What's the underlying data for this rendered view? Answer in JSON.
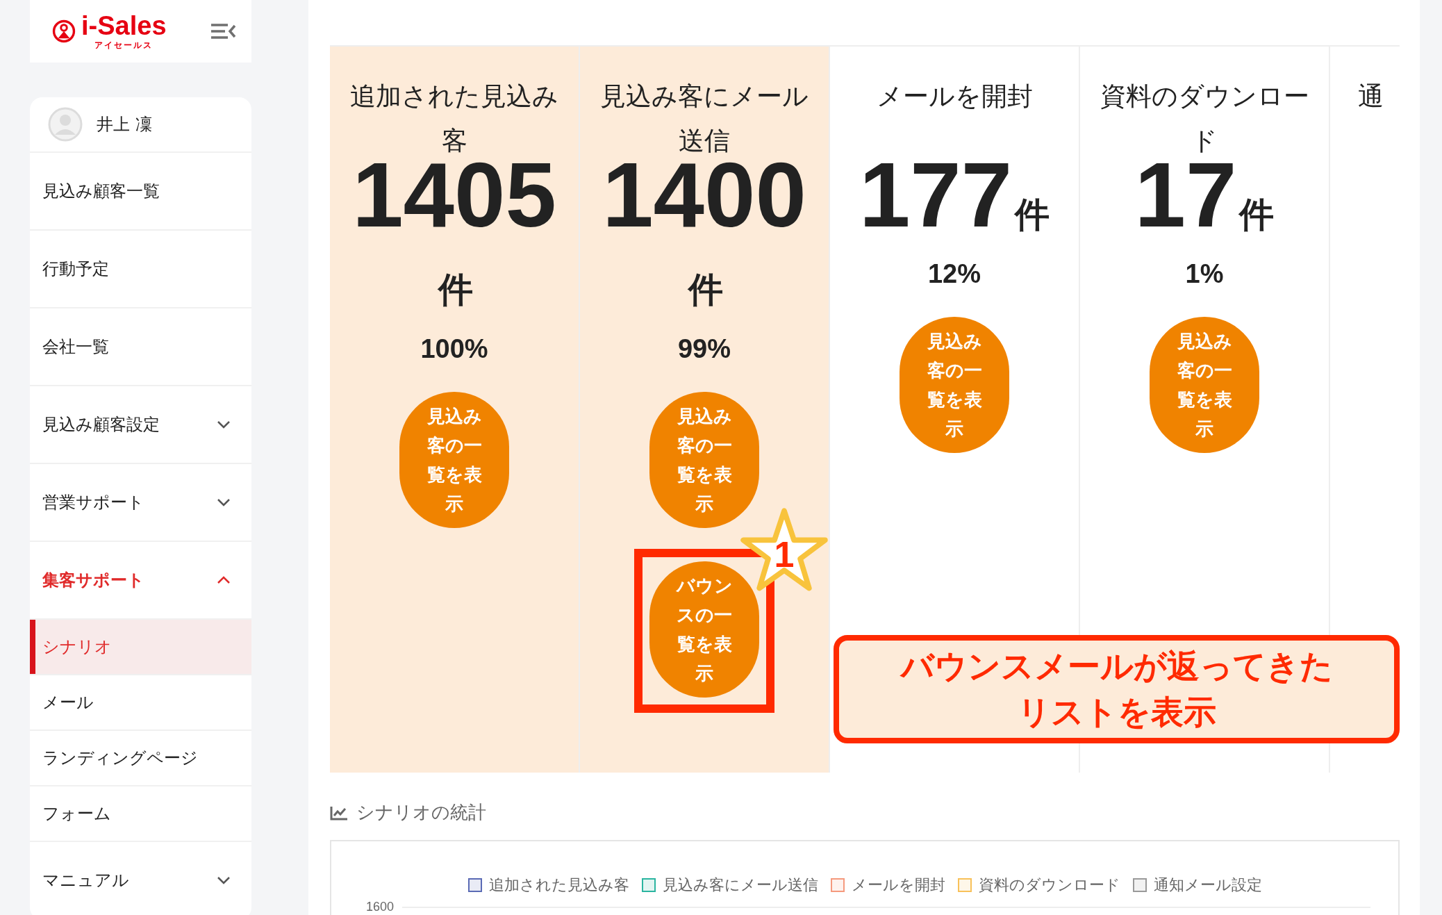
{
  "brand": {
    "name": "i-Sales",
    "kana": "アイセールス"
  },
  "sidebar": {
    "user": "井上 凜",
    "items": [
      {
        "label": "見込み顧客一覧",
        "kind": "link",
        "selected": false
      },
      {
        "label": "行動予定",
        "kind": "link",
        "selected": false
      },
      {
        "label": "会社一覧",
        "kind": "link",
        "selected": false
      },
      {
        "label": "見込み顧客設定",
        "kind": "group",
        "expanded": false,
        "selected": false
      },
      {
        "label": "営業サポート",
        "kind": "group",
        "expanded": false,
        "selected": false
      },
      {
        "label": "集客サポート",
        "kind": "group",
        "expanded": true,
        "selected": true,
        "children": [
          {
            "label": "シナリオ",
            "selected": true
          },
          {
            "label": "メール",
            "selected": false
          },
          {
            "label": "ランディングページ",
            "selected": false
          },
          {
            "label": "フォーム",
            "selected": false
          }
        ]
      },
      {
        "label": "マニュアル",
        "kind": "group",
        "expanded": false,
        "selected": false
      }
    ]
  },
  "metrics": [
    {
      "title": "追加された見込み客",
      "count": "1405",
      "unit": "件",
      "percent": "100%",
      "highlighted": true,
      "buttons": [
        {
          "label": "見込み客の一覧を表示",
          "kind": "list"
        }
      ]
    },
    {
      "title": "見込み客にメール送信",
      "count": "1400",
      "unit": "件",
      "percent": "99%",
      "highlighted": true,
      "buttons": [
        {
          "label": "見込み客の一覧を表示",
          "kind": "list"
        },
        {
          "label": "バウンスの一覧を表示",
          "kind": "bounce"
        }
      ]
    },
    {
      "title": "メールを開封",
      "count": "177",
      "unit": "件",
      "percent": "12%",
      "highlighted": false,
      "buttons": [
        {
          "label": "見込み客の一覧を表示",
          "kind": "list"
        }
      ]
    },
    {
      "title": "資料のダウンロード",
      "count": "17",
      "unit": "件",
      "percent": "1%",
      "highlighted": false,
      "buttons": [
        {
          "label": "見込み客の一覧を表示",
          "kind": "list"
        }
      ]
    },
    {
      "title": "通",
      "highlighted": false
    }
  ],
  "annotation": {
    "step": "1",
    "callout": "バウンスメールが返ってきたリストを表示"
  },
  "stats": {
    "title": "シナリオの統計",
    "legend": [
      {
        "label": "追加された見込み客",
        "color": "#5b6bb5"
      },
      {
        "label": "見込み客にメール送信",
        "color": "#2bb5a0"
      },
      {
        "label": "メールを開封",
        "color": "#f59a7e"
      },
      {
        "label": "資料のダウンロード",
        "color": "#f8c15a"
      },
      {
        "label": "通知メール設定",
        "color": "#9a9a9a"
      }
    ],
    "ytick": "1600"
  }
}
